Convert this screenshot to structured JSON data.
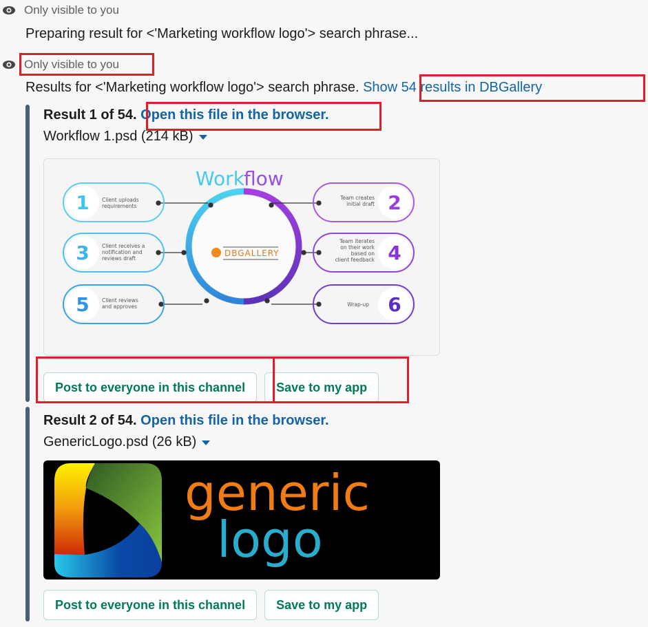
{
  "messages": [
    {
      "ephemeral_label": "Only visible to you",
      "text": "Preparing result for <'Marketing workflow logo'> search phrase..."
    },
    {
      "ephemeral_label": "Only visible to you",
      "text": "Results for <'Marketing workflow logo'> search phrase.",
      "link": "Show 54 results in DBGallery"
    }
  ],
  "results": [
    {
      "title": "Result 1 of 54.",
      "open_link": "Open this file in the browser.",
      "file": "Workflow 1.psd (214 kB)",
      "preview": {
        "kind": "workflow-infographic",
        "heading_a": "Work",
        "heading_b": "flow",
        "center_logo": "DBGALLERY",
        "steps": [
          {
            "num": "1",
            "text": "Client uploads requirements"
          },
          {
            "num": "2",
            "text": "Team creates initial draft"
          },
          {
            "num": "3",
            "text": "Client receives a notification and reviews draft"
          },
          {
            "num": "4",
            "text": "Team iterates on their work based on client feedback"
          },
          {
            "num": "5",
            "text": "Client reviews and approves"
          },
          {
            "num": "6",
            "text": "Wrap-up"
          }
        ]
      },
      "buttons": {
        "post": "Post to everyone in this channel",
        "save": "Save to my app"
      }
    },
    {
      "title": "Result 2 of 54.",
      "open_link": "Open this file in the browser.",
      "file": "GenericLogo.psd (26 kB)",
      "preview": {
        "kind": "logo",
        "word1": "generic",
        "word2": "logo"
      },
      "buttons": {
        "post": "Post to everyone in this channel",
        "save": "Save to my app"
      }
    }
  ],
  "colors": {
    "link": "#1264a3",
    "button_text": "#007a5a",
    "highlight": "#e01e2b",
    "attachment_bar": "#4a5f78"
  }
}
